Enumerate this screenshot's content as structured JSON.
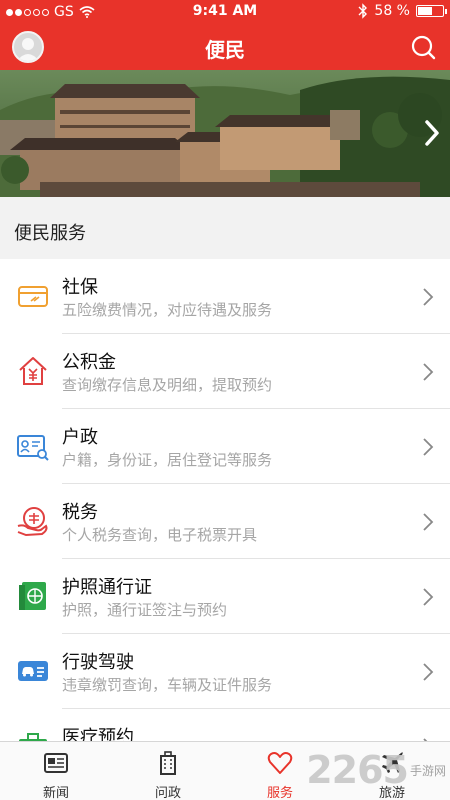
{
  "status": {
    "carrier": "GS",
    "time": "9:41 AM",
    "battery": "58 %",
    "battery_level": 0.58
  },
  "header": {
    "title": "便民"
  },
  "section": {
    "title": "便民服务"
  },
  "services": [
    {
      "name": "社保",
      "desc": "五险缴费情况，对应待遇及服务",
      "icon": "card-icon"
    },
    {
      "name": "公积金",
      "desc": "查询缴存信息及明细，提取预约",
      "icon": "house-yuan-icon"
    },
    {
      "name": "户政",
      "desc": "户籍，身份证，居住登记等服务",
      "icon": "id-card-search-icon"
    },
    {
      "name": "税务",
      "desc": "个人税务查询，电子税票开具",
      "icon": "tax-hand-icon"
    },
    {
      "name": "护照通行证",
      "desc": "护照，通行证签注与预约",
      "icon": "passport-icon"
    },
    {
      "name": "行驶驾驶",
      "desc": "违章缴罚查询，车辆及证件服务",
      "icon": "car-license-icon"
    },
    {
      "name": "医疗预约",
      "desc": "",
      "icon": "medical-kit-icon"
    }
  ],
  "tabs": [
    {
      "label": "新闻",
      "icon": "news-icon"
    },
    {
      "label": "问政",
      "icon": "building-icon"
    },
    {
      "label": "服务",
      "icon": "heart-icon",
      "active": true
    },
    {
      "label": "旅游",
      "icon": "plane-icon"
    }
  ],
  "watermark": {
    "big": "2265",
    "small": "手游网"
  },
  "colors": {
    "brand": "#e8332a",
    "orange": "#f0a030",
    "red_icon": "#e04040",
    "blue_icon": "#3a86d8",
    "green_icon": "#2ea84a"
  }
}
